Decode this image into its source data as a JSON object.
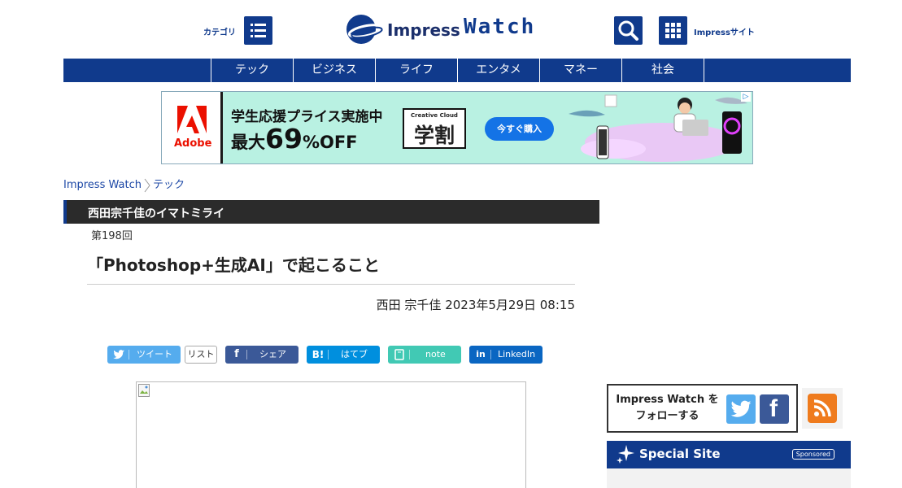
{
  "header": {
    "category_label": "カテゴリ",
    "logo_text_1": "Impress",
    "logo_text_2": "Watch",
    "impress_sites_label": "Impressサイト"
  },
  "nav": {
    "items": [
      "テック",
      "ビジネス",
      "ライフ",
      "エンタメ",
      "マネー",
      "社会"
    ]
  },
  "ad": {
    "brand": "Adobe",
    "line1": "学生応援プライス実施中",
    "line2_prefix": "最大",
    "line2_number": "69",
    "line2_suffix": "%OFF",
    "product_top": "Creative Cloud",
    "product_main": "学割",
    "cta": "今すぐ購入"
  },
  "breadcrumb": [
    "Impress Watch",
    "テック"
  ],
  "article": {
    "series": "西田宗千佳のイマトミライ",
    "episode": "第198回",
    "title": "「Photoshop+生成AI」で起こること",
    "byline": "西田 宗千佳 2023年5月29日 08:15"
  },
  "share": {
    "tweet": "ツイート",
    "list": "リスト",
    "facebook": "シェア",
    "hatena_icon": "B!",
    "hatena": "はてブ",
    "note": "note",
    "linkedin": "LinkedIn"
  },
  "sidebar": {
    "follow_line1": "Impress Watch を",
    "follow_line2": "フォローする",
    "special_title": "Special Site",
    "sponsored": "Sponsored"
  },
  "colors": {
    "brand_blue": "#103a8c",
    "twitter": "#55acee",
    "facebook": "#3b5998",
    "hatena": "#008fde",
    "note": "#41c9b4",
    "linkedin": "#0a66c2",
    "rss": "#ef7b1d"
  },
  "icons": {
    "category": "list-icon",
    "search": "search-icon",
    "sites": "grid-icon",
    "rss": "rss-icon"
  }
}
